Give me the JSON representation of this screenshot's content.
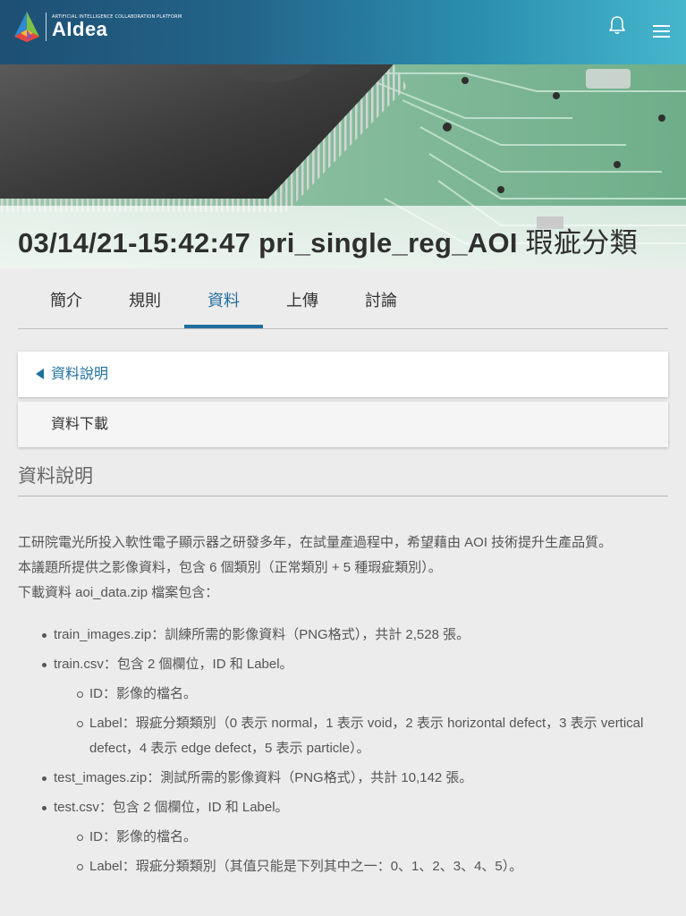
{
  "header": {
    "logo_tagline": "ARTIFICIAL INTELLIGENCE COLLABORATION PLATFORM",
    "logo_word": "AIdea",
    "icons": {
      "notification": "bell-icon",
      "menu": "hamburger-menu-icon"
    },
    "colors": {
      "bar_start": "#1e4f74",
      "bar_end": "#46b6cc"
    }
  },
  "hero": {
    "title_main": "03/14/21-15:42:47 pri_single_reg_AOI",
    "title_suffix": " 瑕疵分類"
  },
  "tabs": [
    {
      "label": "簡介",
      "active": false
    },
    {
      "label": "規則",
      "active": false
    },
    {
      "label": "資料",
      "active": true
    },
    {
      "label": "上傳",
      "active": false
    },
    {
      "label": "討論",
      "active": false
    }
  ],
  "accordion": [
    {
      "label": "資料說明",
      "expanded": true,
      "icon": "caret-left-icon"
    },
    {
      "label": "資料下載",
      "expanded": false
    }
  ],
  "content": {
    "section_title": "資料說明",
    "paragraphs": [
      "工研院電光所投入軟性電子顯示器之研發多年，在試量產過程中，希望藉由 AOI 技術提升生產品質。",
      "本議題所提供之影像資料，包含 6 個類別（正常類別 + 5 種瑕疵類別）。",
      "下載資料 aoi_data.zip 檔案包含："
    ],
    "files": [
      {
        "text": "train_images.zip：訓練所需的影像資料（PNG格式），共計 2,528 張。"
      },
      {
        "text": "train.csv：包含 2 個欄位，ID 和 Label。",
        "sub": [
          "ID：影像的檔名。",
          "Label：瑕疵分類類別（0 表示 normal，1 表示 void，2 表示 horizontal defect，3 表示 vertical defect，4 表示 edge defect，5 表示 particle）。"
        ]
      },
      {
        "text": "test_images.zip：測試所需的影像資料（PNG格式），共計 10,142 張。"
      },
      {
        "text": "test.csv：包含 2 個欄位，ID 和 Label。",
        "sub": [
          "ID：影像的檔名。",
          "Label：瑕疵分類類別（其值只能是下列其中之一：0、1、2、3、4、5）。"
        ]
      }
    ]
  },
  "colors": {
    "accent": "#1f6e9e",
    "page_bg": "#ececec"
  }
}
